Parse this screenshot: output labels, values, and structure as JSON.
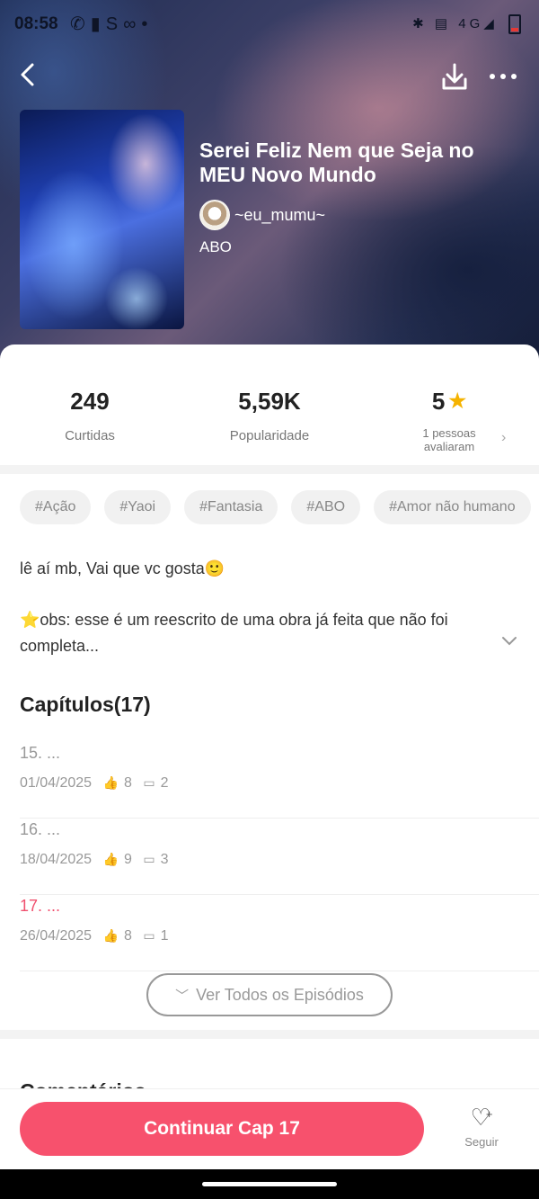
{
  "status_bar": {
    "time": "08:58",
    "left_icons": [
      "whatsapp-icon",
      "sim-icon",
      "s-app-icon",
      "voicemail-icon",
      "dot-icon"
    ],
    "right_icons": [
      "bluetooth-icon",
      "volte-icon",
      "4g-signal-icon",
      "battery-low-icon"
    ],
    "network_label": "4G"
  },
  "header": {
    "back_icon": "chevron-left-icon",
    "download_icon": "download-icon",
    "more_icon": "more-horizontal-icon"
  },
  "book": {
    "title": "Serei Feliz Nem que Seja no MEU Novo Mundo",
    "author": "~eu_mumu~",
    "category": "ABO"
  },
  "stats": {
    "likes_value": "249",
    "likes_label": "Curtidas",
    "popularity_value": "5,59K",
    "popularity_label": "Popularidade",
    "rating_value": "5",
    "rating_label_line1": "1 pessoas",
    "rating_label_line2": "avaliaram"
  },
  "tags": [
    "#Ação",
    "#Yaoi",
    "#Fantasia",
    "#ABO",
    "#Amor não humano"
  ],
  "description": {
    "line1": "lê aí mb, Vai que vc gosta🙂",
    "line2": "⭐obs: esse é um reescrito de uma obra já feita que não foi",
    "line3": "completa..."
  },
  "chapters": {
    "heading": "Capítulos(17)",
    "items": [
      {
        "title": "15. ...",
        "date": "01/04/2025",
        "likes": "8",
        "comments": "2",
        "current": false
      },
      {
        "title": "16. ...",
        "date": "18/04/2025",
        "likes": "9",
        "comments": "3",
        "current": false
      },
      {
        "title": "17. ...",
        "date": "26/04/2025",
        "likes": "8",
        "comments": "1",
        "current": true
      }
    ],
    "see_all_label": "Ver Todos os Episódios"
  },
  "comments": {
    "heading": "Comentários"
  },
  "bottom": {
    "continue_label": "Continuar Cap 17",
    "follow_label": "Seguir"
  },
  "colors": {
    "accent": "#f7516d",
    "current_chapter": "#f0506e",
    "star": "#f5b300"
  }
}
